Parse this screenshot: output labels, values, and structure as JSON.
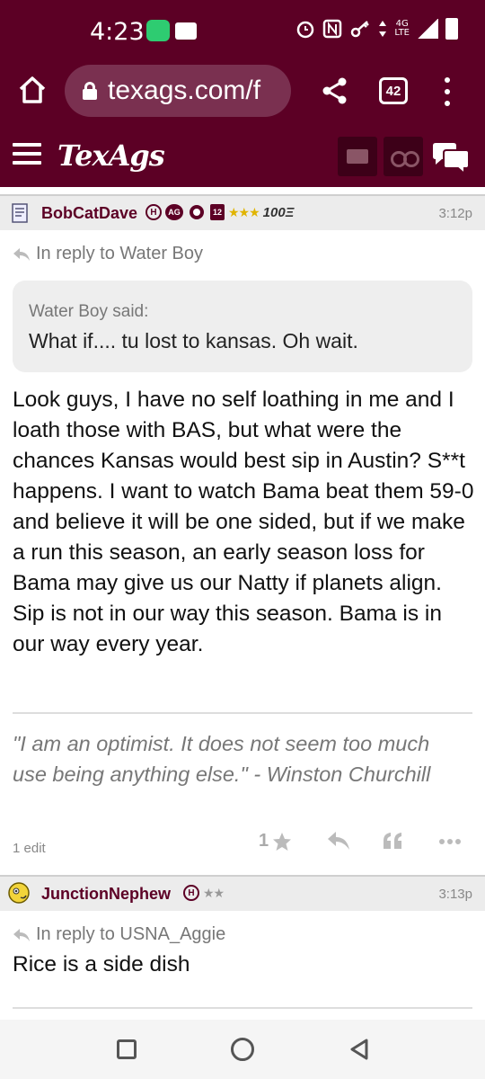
{
  "status_bar": {
    "time": "4:23",
    "network_label_top": "4G",
    "network_label_bottom": "LTE",
    "icons": [
      "chat-notification-icon",
      "mail-notification-icon",
      "alarm-icon",
      "nfc-icon",
      "vpn-key-icon",
      "data-arrows-icon",
      "signal-icon",
      "battery-icon"
    ]
  },
  "browser": {
    "url": "texags.com/f",
    "tab_count": "42"
  },
  "site": {
    "logo": "TexAgs"
  },
  "posts": [
    {
      "username": "BobCatDave",
      "badge_h": "H",
      "badge_ag": "AG",
      "badge_num": "12",
      "stars": "★★★",
      "bonus": "100Ξ",
      "time": "3:12p",
      "reply_to": "In reply to Water Boy",
      "quote_author": "Water Boy said:",
      "quote_text": "What if.... tu lost to kansas. Oh wait.",
      "body": "Look guys, I have no self loathing in me and I loath those with BAS, but what were the chances Kansas would best sip in Austin? S**t happens. I want to watch Bama beat them 59-0 and believe it will be one sided, but if we make a run this season, an early season loss for Bama may give us our Natty if planets align. Sip is not in our way this season. Bama is in our way every year.",
      "signature": "\"I am an optimist. It does not seem too much use being anything else.\" - Winston Churchill",
      "edit_note": "1 edit",
      "star_count": "1",
      "star_color": "#e0b400"
    },
    {
      "username": "JunctionNephew",
      "badge_h": "H",
      "stars": "★★",
      "time": "3:13p",
      "reply_to": "In reply to USNA_Aggie",
      "body": "Rice is a side dish"
    }
  ],
  "colors": {
    "maroon": "#5c0025",
    "maroon_dark": "#3d0018",
    "username": "#5c0025",
    "gold_stars": "#e0b400"
  }
}
